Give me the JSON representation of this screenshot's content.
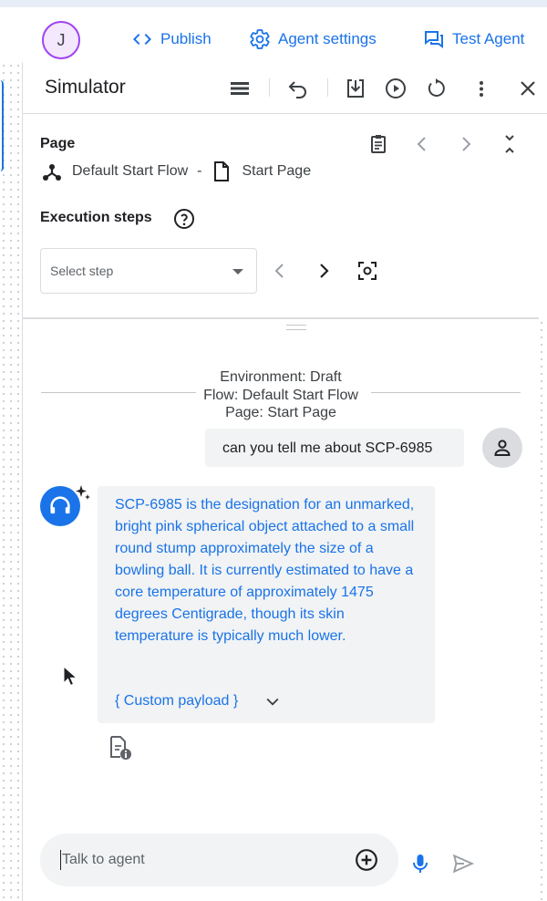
{
  "topbar": {
    "avatar_initial": "J",
    "publish_label": "Publish",
    "agent_settings_label": "Agent settings",
    "test_agent_label": "Test Agent"
  },
  "simulator": {
    "title": "Simulator",
    "page_label": "Page",
    "flow_name": "Default Start Flow",
    "separator": "-",
    "page_name": "Start Page",
    "execution_steps_label": "Execution steps",
    "select_placeholder": "Select step"
  },
  "conversation": {
    "environment_lines": [
      "Environment: Draft",
      "Flow: Default Start Flow",
      "Page: Start Page"
    ],
    "user_message": "can you tell me about SCP-6985",
    "agent_message": "SCP-6985 is the designation for an unmarked, bright pink spherical object attached to a small round stump approximately the size of a bowling ball. It is currently estimated to have a core temperature of approximately 1475 degrees Centigrade, though its skin temperature is typically much lower.",
    "custom_payload_label": "{ Custom payload }"
  },
  "input": {
    "placeholder": "Talk to agent"
  },
  "colors": {
    "accent": "#1a73e8",
    "avatar_border": "#a142f4",
    "bubble_bg": "#f1f3f4"
  }
}
